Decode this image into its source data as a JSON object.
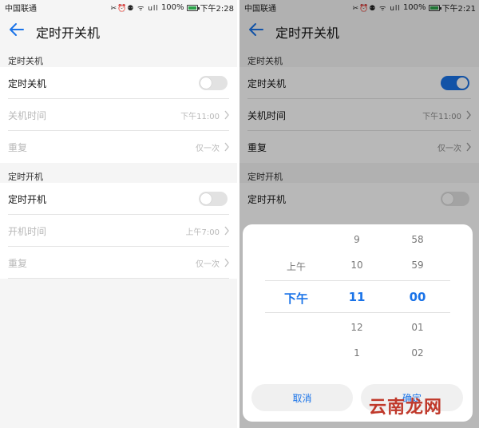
{
  "left": {
    "status": {
      "carrier": "中国联通",
      "icons": "✂⏰⚉ ᯤ ull",
      "battery": "100%",
      "time": "下午2:28",
      "battery_level": 1.0
    },
    "header": {
      "title": "定时开关机"
    },
    "shutdown": {
      "section": "定时关机",
      "toggle_label": "定时关机",
      "toggle_on": false,
      "time_label": "关机时间",
      "time_value": "下午11:00",
      "repeat_label": "重复",
      "repeat_value": "仅一次"
    },
    "boot": {
      "section": "定时开机",
      "toggle_label": "定时开机",
      "toggle_on": false,
      "time_label": "开机时间",
      "time_value": "上午7:00",
      "repeat_label": "重复",
      "repeat_value": "仅一次"
    }
  },
  "right": {
    "status": {
      "carrier": "中国联通",
      "icons": "✂⏰⚉ ᯤ ull",
      "battery": "100%",
      "time": "下午2:21",
      "battery_level": 1.0
    },
    "header": {
      "title": "定时开关机"
    },
    "shutdown": {
      "section": "定时关机",
      "toggle_label": "定时关机",
      "toggle_on": true,
      "time_label": "关机时间",
      "time_value": "下午11:00",
      "repeat_label": "重复",
      "repeat_value": "仅一次"
    },
    "boot": {
      "section": "定时开机",
      "toggle_label": "定时开机",
      "toggle_on": false
    },
    "picker": {
      "ampm": [
        "上午",
        "下午"
      ],
      "hours": [
        "9",
        "10",
        "11",
        "12",
        "1"
      ],
      "minutes": [
        "58",
        "59",
        "00",
        "01",
        "02"
      ],
      "selected": {
        "ampm": "下午",
        "hour": "11",
        "minute": "00"
      },
      "cancel_label": "取消",
      "confirm_label": "确定"
    }
  },
  "watermark": "云南龙网",
  "colors": {
    "accent": "#1a73e8",
    "watermark": "#c0392b"
  }
}
